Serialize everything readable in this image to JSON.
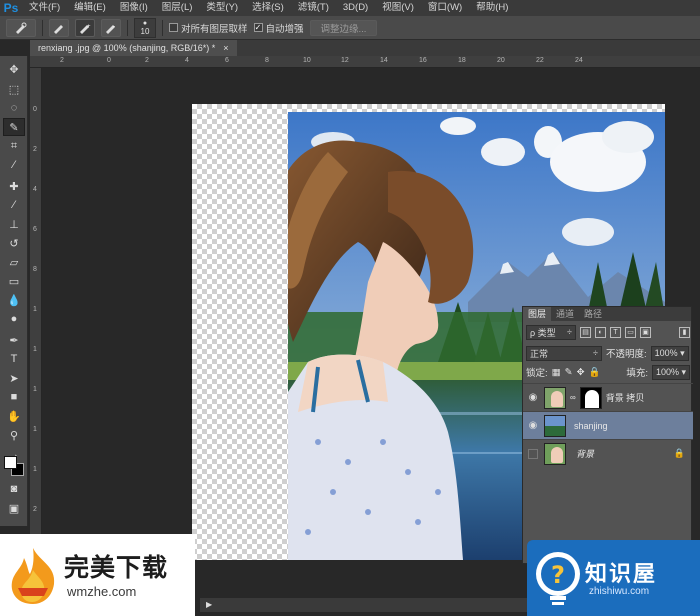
{
  "app": {
    "logo": "Ps"
  },
  "menu": [
    "文件(F)",
    "编辑(E)",
    "图像(I)",
    "图层(L)",
    "类型(Y)",
    "选择(S)",
    "滤镜(T)",
    "3D(D)",
    "视图(V)",
    "窗口(W)",
    "帮助(H)"
  ],
  "options": {
    "brush_size": "10",
    "sample_all_layers": "对所有图层取样",
    "auto_enhance": "自动增强",
    "auto_enhance_checked": "✓",
    "refine_edge": "调整边缘..."
  },
  "document_tab": {
    "title": "renxiang .jpg @ 100% (shanjing, RGB/16*) *",
    "close": "×"
  },
  "ruler": {
    "top_labels": [
      "2",
      "0",
      "2",
      "4",
      "6",
      "8",
      "10",
      "12",
      "14",
      "16",
      "18",
      "20",
      "22",
      "24"
    ],
    "left_labels": [
      "0",
      "2",
      "4",
      "6",
      "8",
      "1",
      "1",
      "1",
      "1",
      "1",
      "2"
    ]
  },
  "layers_panel": {
    "tabs": [
      "图层",
      "通道",
      "路径"
    ],
    "filter_label": "ρ 类型",
    "blend_mode": "正常",
    "opacity_label": "不透明度:",
    "opacity_value": "100%",
    "lock_label": "锁定:",
    "fill_label": "填充:",
    "fill_value": "100%",
    "layers": [
      {
        "name": "背景 拷贝",
        "visible": true,
        "selected": false
      },
      {
        "name": "shanjing",
        "visible": true,
        "selected": true
      },
      {
        "name": "背景",
        "visible": false,
        "selected": false,
        "locked": true
      }
    ]
  },
  "watermark_left": {
    "title": "完美下载",
    "site": "wmzhe.com"
  },
  "watermark_right": {
    "title": "知识屋",
    "site": "zhishiwu.com"
  },
  "colors": {
    "accent": "#1f8fe0",
    "selected_layer": "#6d7f9c",
    "foreground": "#ffffff",
    "background": "#000000"
  }
}
